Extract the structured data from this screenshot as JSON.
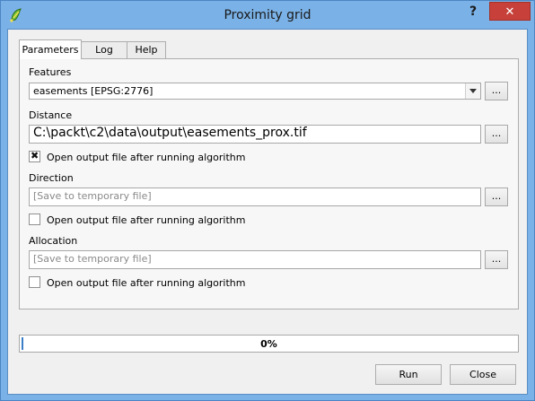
{
  "window": {
    "title": "Proximity grid",
    "help_label": "?",
    "close_label": "✕"
  },
  "tabs": [
    {
      "label": "Parameters",
      "active": true
    },
    {
      "label": "Log",
      "active": false
    },
    {
      "label": "Help",
      "active": false
    }
  ],
  "features": {
    "label": "Features",
    "value": "easements [EPSG:2776]",
    "browse_label": "..."
  },
  "distance": {
    "label": "Distance",
    "value": "C:\\packt\\c2\\data\\output\\easements_prox.tif",
    "browse_label": "...",
    "open_label": "Open output file after running algorithm",
    "open_checked": true
  },
  "direction": {
    "label": "Direction",
    "placeholder": "[Save to temporary file]",
    "browse_label": "...",
    "open_label": "Open output file after running algorithm",
    "open_checked": false
  },
  "allocation": {
    "label": "Allocation",
    "placeholder": "[Save to temporary file]",
    "browse_label": "...",
    "open_label": "Open output file after running algorithm",
    "open_checked": false
  },
  "progress": {
    "label": "0%",
    "value": 0
  },
  "buttons": {
    "run_label": "Run",
    "close_label": "Close"
  },
  "colors": {
    "titlebar": "#7ab1e6",
    "close_button": "#c7413a",
    "progress_fill": "#3b7ec8"
  }
}
